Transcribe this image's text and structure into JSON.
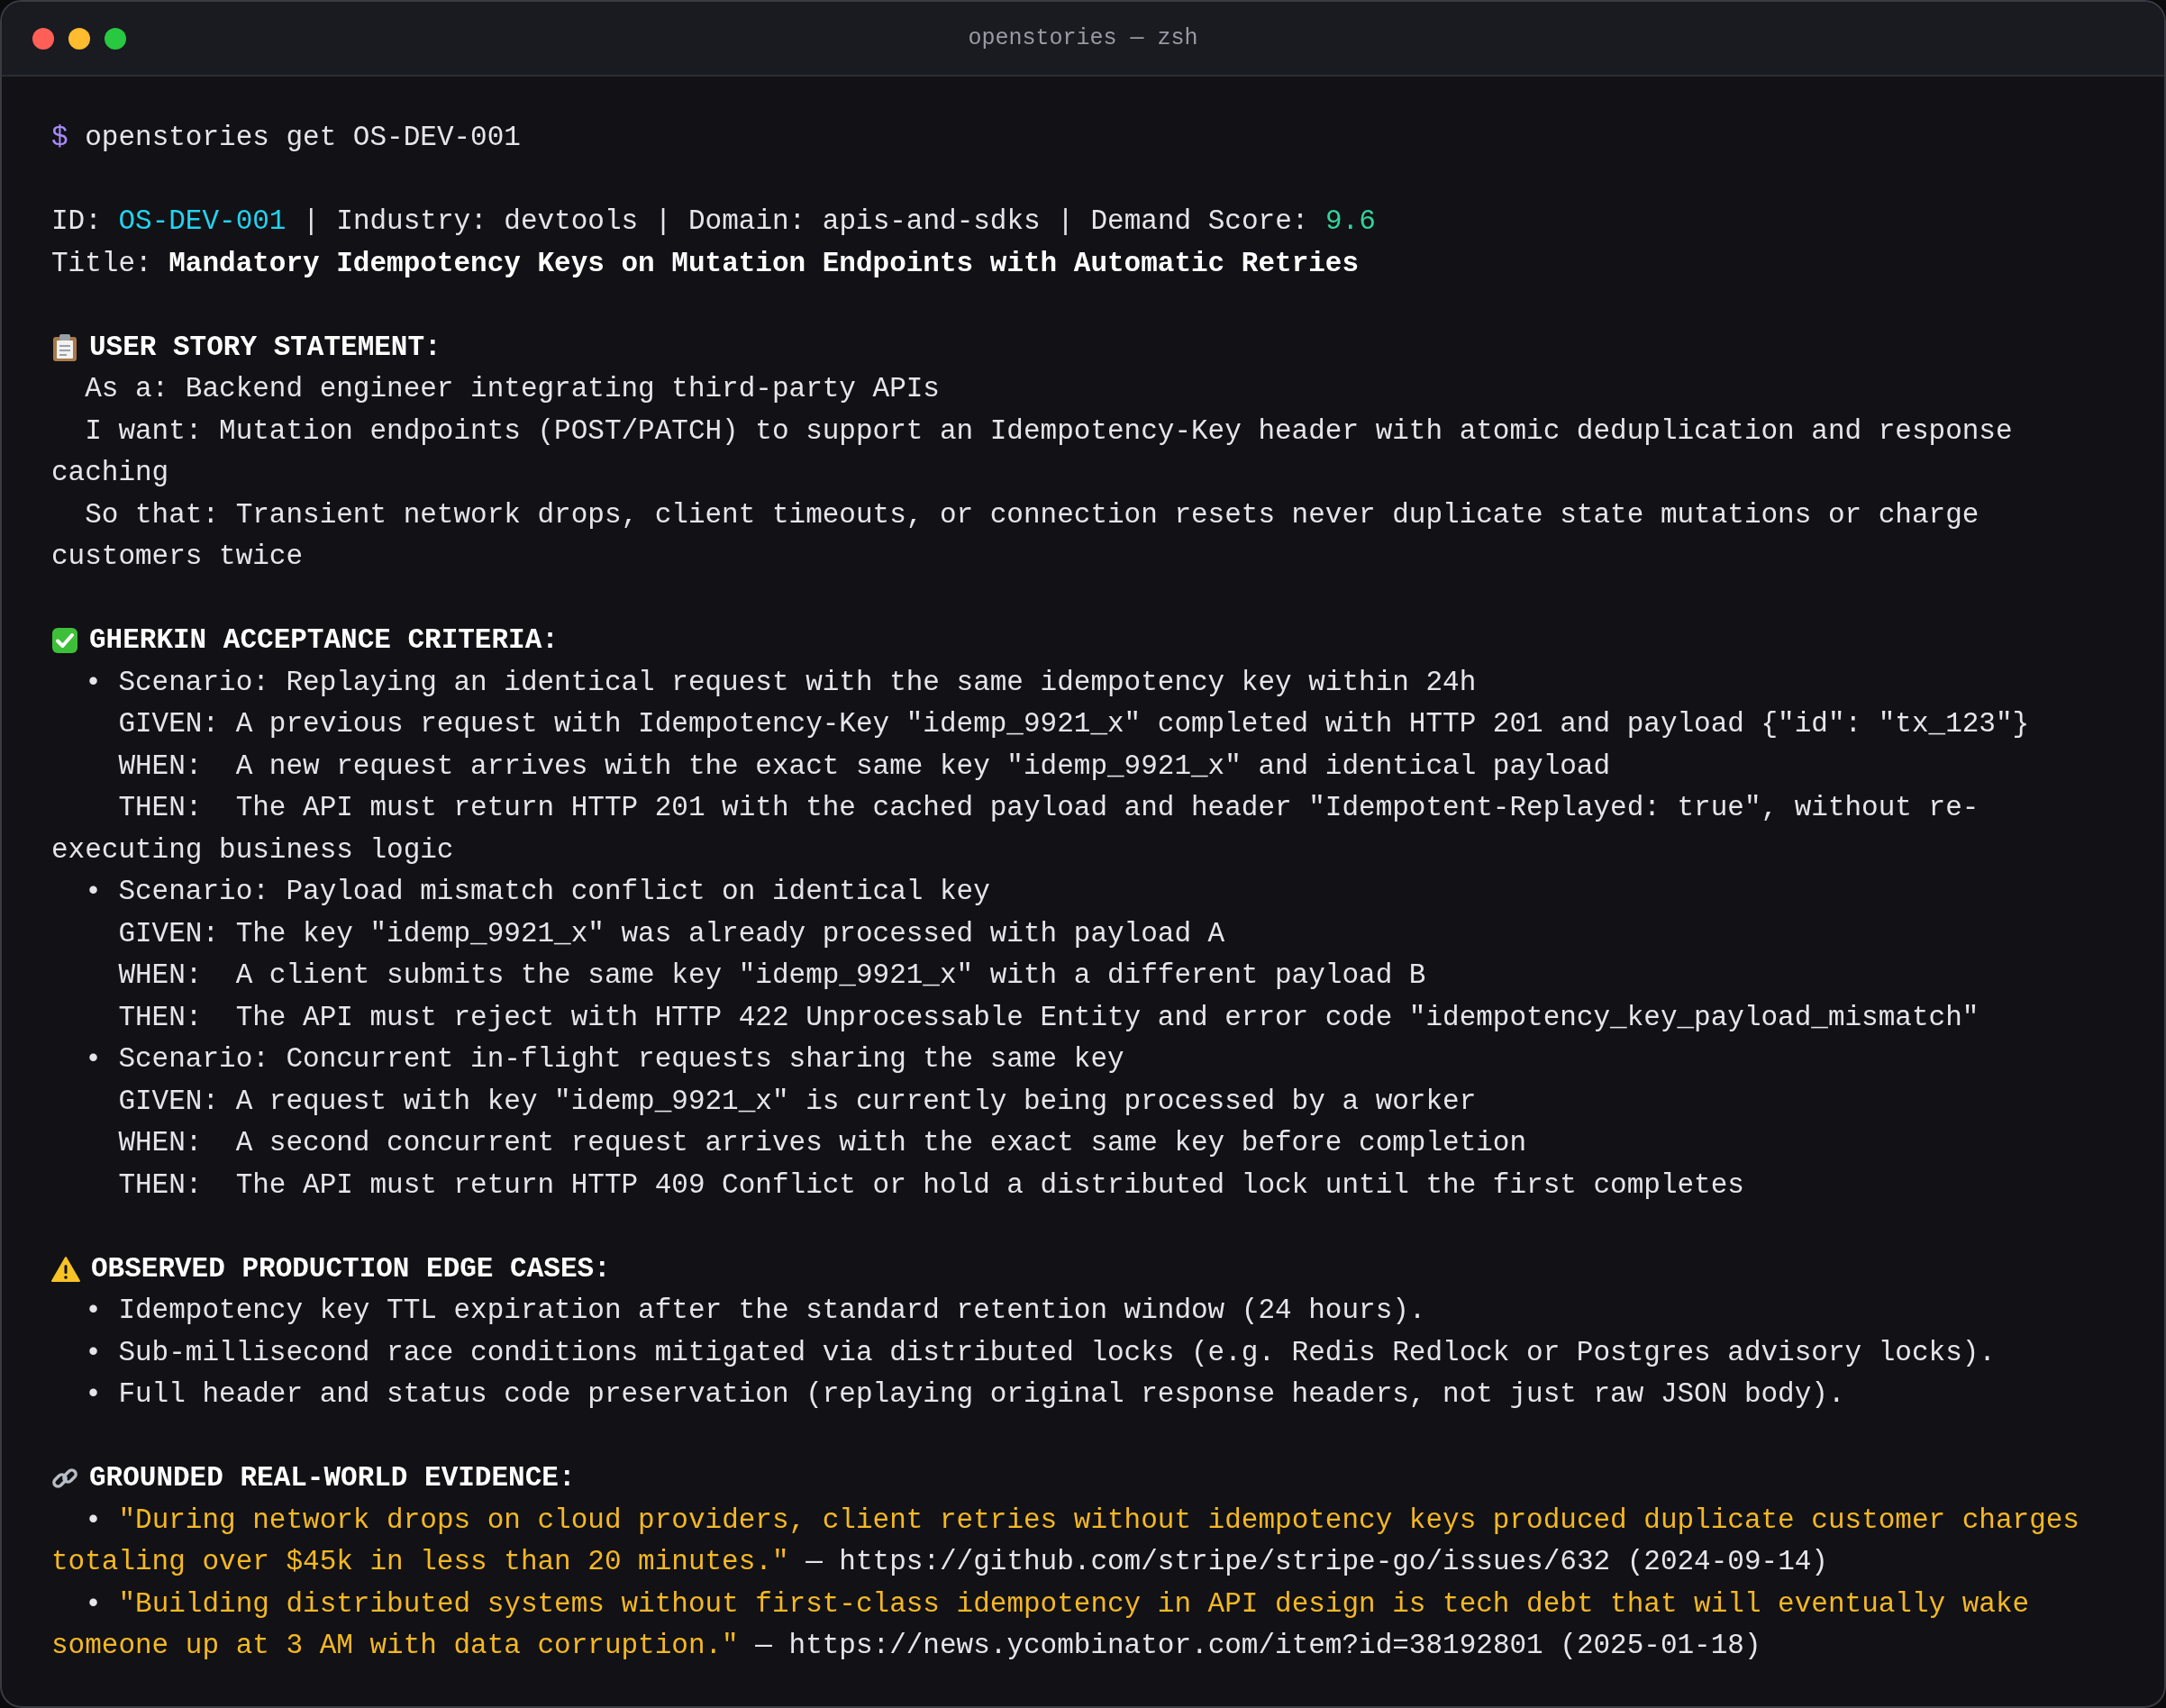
{
  "window": {
    "title": "openstories — zsh"
  },
  "prompt": {
    "symbol": "$",
    "command": "openstories get OS-DEV-001"
  },
  "meta": {
    "separator": "|",
    "fields": [
      {
        "label": "ID:",
        "value": "OS-DEV-001",
        "kind": "id"
      },
      {
        "label": "Industry:",
        "value": "devtools",
        "kind": "text"
      },
      {
        "label": "Domain:",
        "value": "apis-and-sdks",
        "kind": "text"
      },
      {
        "label": "Demand Score:",
        "value": "9.6",
        "kind": "score"
      }
    ]
  },
  "title": {
    "label": "Title:",
    "value": "Mandatory Idempotency Keys on Mutation Endpoints with Automatic Retries"
  },
  "sections": [
    {
      "kind": "story",
      "heading": "USER STORY STATEMENT:",
      "items": [
        {
          "text": "As a: Backend engineer integrating third-party APIs"
        },
        {
          "text": "I want: Mutation endpoints (POST/PATCH) to support an Idempotency-Key header with atomic deduplication and response caching"
        },
        {
          "text": "So that: Transient network drops, client timeouts, or connection resets never duplicate state mutations or charge customers twice"
        }
      ]
    },
    {
      "kind": "criteria",
      "heading": "GHERKIN ACCEPTANCE CRITERIA:",
      "scenarios": [
        {
          "bullet": "•",
          "title": "Scenario: Replaying an identical request with the same idempotency key within 24h",
          "steps": [
            {
              "keyword": "GIVEN:",
              "text": "A previous request with Idempotency-Key \"idemp_9921_x\" completed with HTTP 201 and payload {\"id\": \"tx_123\"}"
            },
            {
              "keyword": "WHEN:",
              "text": "A new request arrives with the exact same key \"idemp_9921_x\" and identical payload"
            },
            {
              "keyword": "THEN:",
              "text": "The API must return HTTP 201 with the cached payload and header \"Idempotent-Replayed: true\", without re-executing business logic"
            }
          ]
        },
        {
          "bullet": "•",
          "title": "Scenario: Payload mismatch conflict on identical key",
          "steps": [
            {
              "keyword": "GIVEN:",
              "text": "The key \"idemp_9921_x\" was already processed with payload A"
            },
            {
              "keyword": "WHEN:",
              "text": "A client submits the same key \"idemp_9921_x\" with a different payload B"
            },
            {
              "keyword": "THEN:",
              "text": "The API must reject with HTTP 422 Unprocessable Entity and error code \"idempotency_key_payload_mismatch\""
            }
          ]
        },
        {
          "bullet": "•",
          "title": "Scenario: Concurrent in-flight requests sharing the same key",
          "steps": [
            {
              "keyword": "GIVEN:",
              "text": "A request with key \"idemp_9921_x\" is currently being processed by a worker"
            },
            {
              "keyword": "WHEN:",
              "text": "A second concurrent request arrives with the exact same key before completion"
            },
            {
              "keyword": "THEN:",
              "text": "The API must return HTTP 409 Conflict or hold a distributed lock until the first completes"
            }
          ]
        }
      ]
    },
    {
      "kind": "edge",
      "heading": "OBSERVED PRODUCTION EDGE CASES:",
      "items": [
        {
          "bullet": "•",
          "text": "Idempotency key TTL expiration after the standard retention window (24 hours)."
        },
        {
          "bullet": "•",
          "text": "Sub-millisecond race conditions mitigated via distributed locks (e.g. Redis Redlock or Postgres advisory locks)."
        },
        {
          "bullet": "•",
          "text": "Full header and status code preservation (replaying original response headers, not just raw JSON body)."
        }
      ]
    },
    {
      "kind": "evidence",
      "heading": "GROUNDED REAL-WORLD EVIDENCE:",
      "items": [
        {
          "bullet": "•",
          "quote": "\"During network drops on cloud providers, client retries without idempotency keys produced duplicate customer charges totaling over $45k in less than 20 minutes.\"",
          "source": "— https://github.com/stripe/stripe-go/issues/632 (2024-09-14)"
        },
        {
          "bullet": "•",
          "quote": "\"Building distributed systems without first-class idempotency in API design is tech debt that will eventually wake someone up at 3 AM with data corruption.\"",
          "source": "— https://news.ycombinator.com/item?id=38192801 (2025-01-18)"
        }
      ]
    }
  ]
}
